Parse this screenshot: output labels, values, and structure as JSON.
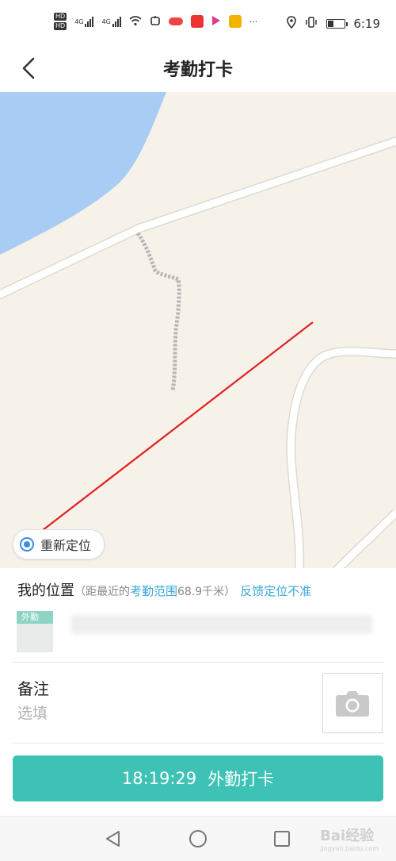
{
  "status_bar": {
    "network": "4G",
    "network2": "4G",
    "hd_labels": [
      "HD",
      "HD"
    ],
    "more": "···",
    "time": "6:19",
    "battery_level": 0.35
  },
  "header": {
    "title": "考勤打卡"
  },
  "map": {
    "relocate_label": "重新定位",
    "colors": {
      "water": "#a9ccf5",
      "land": "#f6f2ea",
      "road": "#ffffff",
      "track": "#b0b0b0",
      "arrow": "#e02020"
    }
  },
  "location": {
    "label": "我的位置",
    "open_paren": "（距最近的",
    "range_link": "考勤范围",
    "distance": "68.9千米",
    "close_paren": "）",
    "feedback": "反馈定位不准",
    "tag": "外勤"
  },
  "remark": {
    "label": "备注",
    "placeholder": "选填"
  },
  "punch": {
    "time": "18:19:29",
    "label": "外勤打卡"
  },
  "watermark": {
    "text": "Bai",
    "text2": "经验",
    "url": "jingyan.baidu.com"
  }
}
